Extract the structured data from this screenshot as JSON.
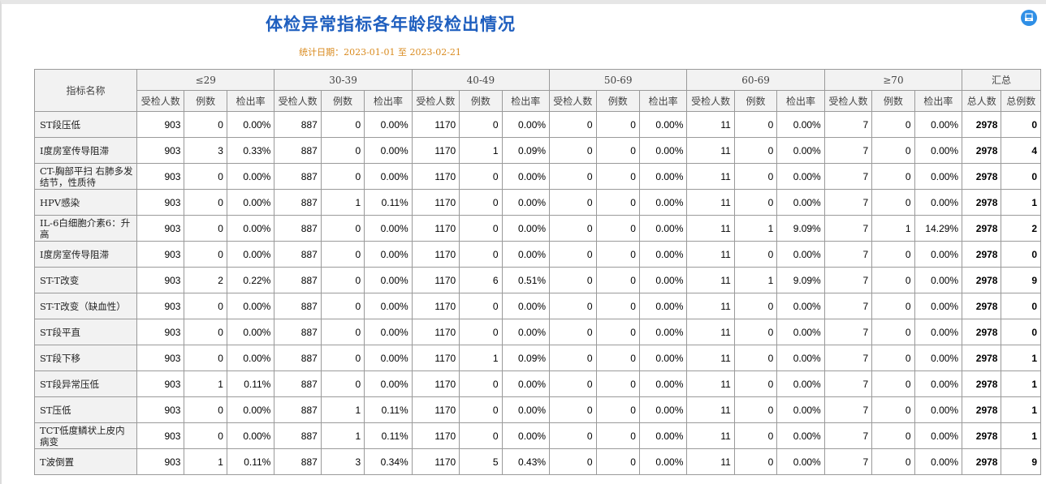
{
  "title": "体检异常指标各年龄段检出情况",
  "subtitle": "统计日期：2023-01-01 至 2023-02-21",
  "header": {
    "name_label": "指标名称",
    "age_groups": [
      "≤29",
      "30-39",
      "40-49",
      "50-69",
      "60-69",
      "≥70"
    ],
    "summary_label": "汇总",
    "sub_labels": [
      "受检人数",
      "例数",
      "检出率"
    ],
    "summary_sub_labels": [
      "总人数",
      "总例数"
    ]
  },
  "rows": [
    {
      "name": "ST段压低",
      "cells": [
        "903",
        "0",
        "0.00%",
        "887",
        "0",
        "0.00%",
        "1170",
        "0",
        "0.00%",
        "0",
        "0",
        "0.00%",
        "11",
        "0",
        "0.00%",
        "7",
        "0",
        "0.00%",
        "2978",
        "0"
      ]
    },
    {
      "name": "Ⅰ度房室传导阻滞",
      "cells": [
        "903",
        "3",
        "0.33%",
        "887",
        "0",
        "0.00%",
        "1170",
        "1",
        "0.09%",
        "0",
        "0",
        "0.00%",
        "11",
        "0",
        "0.00%",
        "7",
        "0",
        "0.00%",
        "2978",
        "4"
      ]
    },
    {
      "name": "CT-胸部平扫 右肺多发结节，性质待",
      "cells": [
        "903",
        "0",
        "0.00%",
        "887",
        "0",
        "0.00%",
        "1170",
        "0",
        "0.00%",
        "0",
        "0",
        "0.00%",
        "11",
        "0",
        "0.00%",
        "7",
        "0",
        "0.00%",
        "2978",
        "0"
      ]
    },
    {
      "name": "HPV感染",
      "cells": [
        "903",
        "0",
        "0.00%",
        "887",
        "1",
        "0.11%",
        "1170",
        "0",
        "0.00%",
        "0",
        "0",
        "0.00%",
        "11",
        "0",
        "0.00%",
        "7",
        "0",
        "0.00%",
        "2978",
        "1"
      ]
    },
    {
      "name": "IL-6白细胞介素6：升高",
      "cells": [
        "903",
        "0",
        "0.00%",
        "887",
        "0",
        "0.00%",
        "1170",
        "0",
        "0.00%",
        "0",
        "0",
        "0.00%",
        "11",
        "1",
        "9.09%",
        "7",
        "1",
        "14.29%",
        "2978",
        "2"
      ]
    },
    {
      "name": "I度房室传导阻滞",
      "cells": [
        "903",
        "0",
        "0.00%",
        "887",
        "0",
        "0.00%",
        "1170",
        "0",
        "0.00%",
        "0",
        "0",
        "0.00%",
        "11",
        "0",
        "0.00%",
        "7",
        "0",
        "0.00%",
        "2978",
        "0"
      ]
    },
    {
      "name": "ST-T改变",
      "cells": [
        "903",
        "2",
        "0.22%",
        "887",
        "0",
        "0.00%",
        "1170",
        "6",
        "0.51%",
        "0",
        "0",
        "0.00%",
        "11",
        "1",
        "9.09%",
        "7",
        "0",
        "0.00%",
        "2978",
        "9"
      ]
    },
    {
      "name": "ST-T改变（缺血性）",
      "cells": [
        "903",
        "0",
        "0.00%",
        "887",
        "0",
        "0.00%",
        "1170",
        "0",
        "0.00%",
        "0",
        "0",
        "0.00%",
        "11",
        "0",
        "0.00%",
        "7",
        "0",
        "0.00%",
        "2978",
        "0"
      ]
    },
    {
      "name": "ST段平直",
      "cells": [
        "903",
        "0",
        "0.00%",
        "887",
        "0",
        "0.00%",
        "1170",
        "0",
        "0.00%",
        "0",
        "0",
        "0.00%",
        "11",
        "0",
        "0.00%",
        "7",
        "0",
        "0.00%",
        "2978",
        "0"
      ]
    },
    {
      "name": "ST段下移",
      "cells": [
        "903",
        "0",
        "0.00%",
        "887",
        "0",
        "0.00%",
        "1170",
        "1",
        "0.09%",
        "0",
        "0",
        "0.00%",
        "11",
        "0",
        "0.00%",
        "7",
        "0",
        "0.00%",
        "2978",
        "1"
      ]
    },
    {
      "name": "ST段异常压低",
      "cells": [
        "903",
        "1",
        "0.11%",
        "887",
        "0",
        "0.00%",
        "1170",
        "0",
        "0.00%",
        "0",
        "0",
        "0.00%",
        "11",
        "0",
        "0.00%",
        "7",
        "0",
        "0.00%",
        "2978",
        "1"
      ]
    },
    {
      "name": "ST压低",
      "cells": [
        "903",
        "0",
        "0.00%",
        "887",
        "1",
        "0.11%",
        "1170",
        "0",
        "0.00%",
        "0",
        "0",
        "0.00%",
        "11",
        "0",
        "0.00%",
        "7",
        "0",
        "0.00%",
        "2978",
        "1"
      ]
    },
    {
      "name": "TCT低度鳞状上皮内病变",
      "cells": [
        "903",
        "0",
        "0.00%",
        "887",
        "1",
        "0.11%",
        "1170",
        "0",
        "0.00%",
        "0",
        "0",
        "0.00%",
        "11",
        "0",
        "0.00%",
        "7",
        "0",
        "0.00%",
        "2978",
        "1"
      ]
    },
    {
      "name": "T波倒置",
      "cells": [
        "903",
        "1",
        "0.11%",
        "887",
        "3",
        "0.34%",
        "1170",
        "5",
        "0.43%",
        "0",
        "0",
        "0.00%",
        "11",
        "0",
        "0.00%",
        "7",
        "0",
        "0.00%",
        "2978",
        "9"
      ]
    }
  ],
  "colors": {
    "title": "#1f5fbf",
    "subtitle": "#d98a1e",
    "header_bg": "#f2f2f2",
    "accent": "#2f8fe6"
  },
  "icons": {
    "export": "export-icon"
  }
}
